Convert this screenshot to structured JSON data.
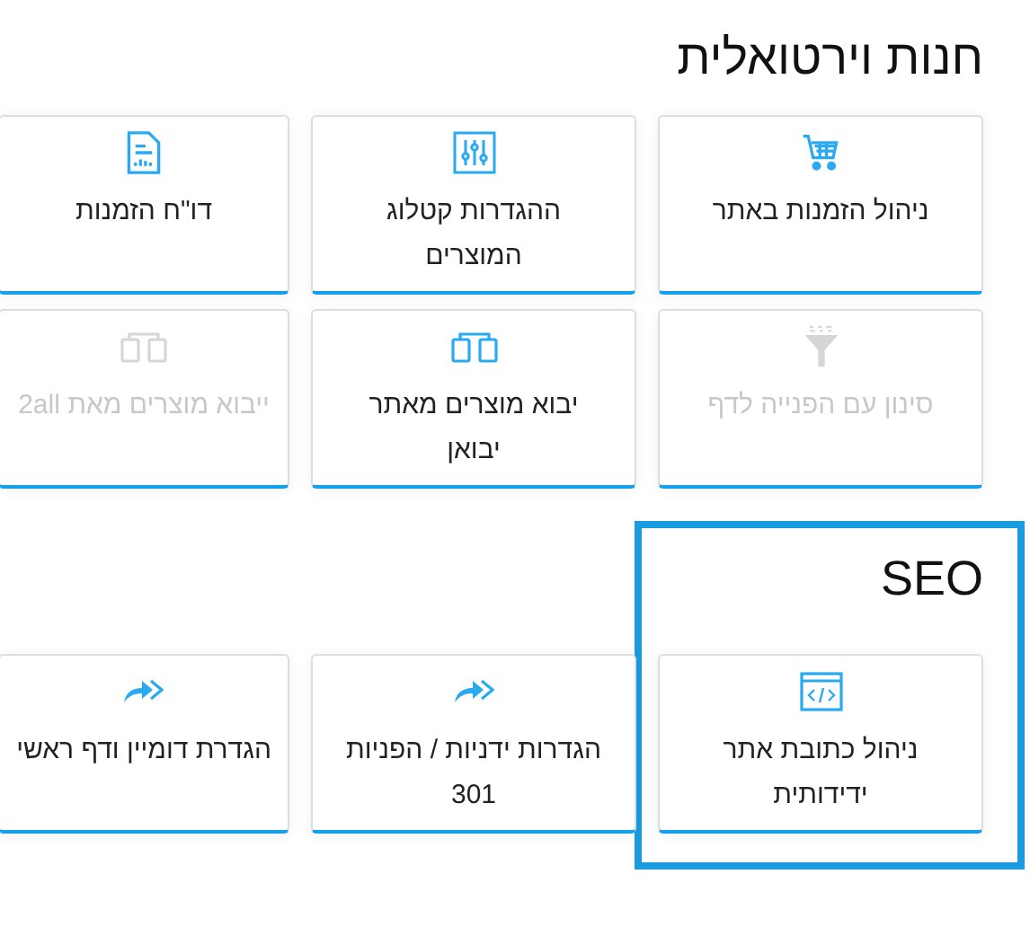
{
  "sections": [
    {
      "title": "חנות וירטואלית",
      "highlighted": false,
      "cards": [
        {
          "label": "ניהול הזמנות באתר",
          "kind": "cart",
          "disabled": false
        },
        {
          "label": "ההגדרות קטלוג המוצרים",
          "kind": "sliders",
          "disabled": false
        },
        {
          "label": "דו\"ח הזמנות",
          "kind": "report",
          "disabled": false
        },
        {
          "label": "סינון עם הפנייה לדף",
          "kind": "funnel",
          "disabled": true
        },
        {
          "label": "יבוא מוצרים מאתר יבואן",
          "kind": "transfer",
          "disabled": false
        },
        {
          "label": "ייבוא מוצרים מאת 2all",
          "kind": "transfer",
          "disabled": true
        }
      ]
    },
    {
      "title": "SEO",
      "highlighted": true,
      "cards": [
        {
          "label": "ניהול כתובת אתר ידידותית",
          "kind": "code",
          "disabled": false
        },
        {
          "label": "הגדרות ידניות / הפניות 301",
          "kind": "share",
          "disabled": false
        },
        {
          "label": "הגדרת דומיין ודף ראשי",
          "kind": "share",
          "disabled": false
        }
      ]
    }
  ]
}
